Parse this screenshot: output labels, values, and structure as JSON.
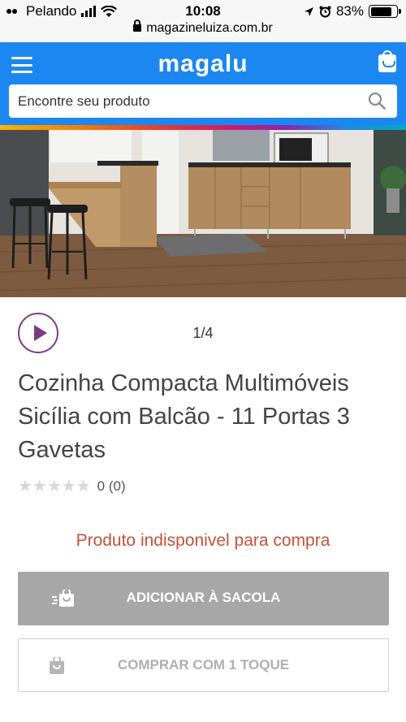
{
  "status_bar": {
    "carrier": "Pelando",
    "time": "10:08",
    "battery_percent": "83%",
    "battery_level": 0.83,
    "icons": [
      "signal-icon",
      "wifi-icon",
      "location-icon",
      "alarm-icon",
      "battery-icon"
    ]
  },
  "browser": {
    "url": "magazineluiza.com.br"
  },
  "header": {
    "logo": "magalu",
    "search_placeholder": "Encontre seu produto",
    "colors": {
      "primary": "#1c87f0"
    }
  },
  "product": {
    "image_counter": "1/4",
    "title": "Cozinha Compacta Multimóveis Sicília com Balcão - 11 Portas 3 Gavetas",
    "rating_stars": "★★★★★",
    "rating_value": 0,
    "rating_text": "0 (0)",
    "unavailable_message": "Produto indisponivel para compra"
  },
  "actions": {
    "add_to_bag": "ADICIONAR À SACOLA",
    "buy_one_click": "COMPRAR COM 1 TOQUE"
  },
  "colors": {
    "unavailable": "#c3513a",
    "play_accent": "#7e3b84",
    "disabled_button": "#a7a7a7"
  }
}
